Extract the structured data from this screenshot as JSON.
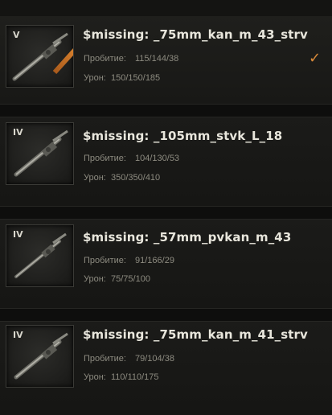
{
  "modules": [
    {
      "tier": "V",
      "name": "$missing: _75mm_kan_m_43_strv",
      "penetration_label": "Пробитие:",
      "penetration": "115/144/38",
      "damage_label": "Урон:",
      "damage": "150/150/185",
      "selected": true,
      "check": "✓"
    },
    {
      "tier": "IV",
      "name": "$missing: _105mm_stvk_L_18",
      "penetration_label": "Пробитие:",
      "penetration": "104/130/53",
      "damage_label": "Урон:",
      "damage": "350/350/410",
      "selected": false
    },
    {
      "tier": "IV",
      "name": "$missing: _57mm_pvkan_m_43",
      "penetration_label": "Пробитие:",
      "penetration": "91/166/29",
      "damage_label": "Урон:",
      "damage": "75/75/100",
      "selected": false
    },
    {
      "tier": "IV",
      "name": "$missing: _75mm_kan_m_41_strv",
      "penetration_label": "Пробитие:",
      "penetration": "79/104/38",
      "damage_label": "Урон:",
      "damage": "110/110/175",
      "selected": false
    }
  ]
}
